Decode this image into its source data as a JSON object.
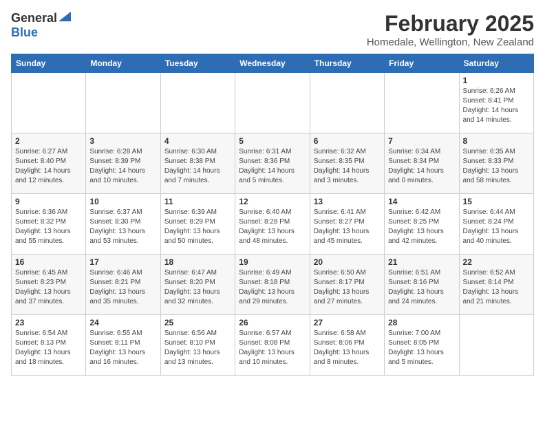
{
  "logo": {
    "general": "General",
    "blue": "Blue"
  },
  "title": "February 2025",
  "location": "Homedale, Wellington, New Zealand",
  "weekdays": [
    "Sunday",
    "Monday",
    "Tuesday",
    "Wednesday",
    "Thursday",
    "Friday",
    "Saturday"
  ],
  "weeks": [
    [
      {
        "day": "",
        "info": ""
      },
      {
        "day": "",
        "info": ""
      },
      {
        "day": "",
        "info": ""
      },
      {
        "day": "",
        "info": ""
      },
      {
        "day": "",
        "info": ""
      },
      {
        "day": "",
        "info": ""
      },
      {
        "day": "1",
        "info": "Sunrise: 6:26 AM\nSunset: 8:41 PM\nDaylight: 14 hours\nand 14 minutes."
      }
    ],
    [
      {
        "day": "2",
        "info": "Sunrise: 6:27 AM\nSunset: 8:40 PM\nDaylight: 14 hours\nand 12 minutes."
      },
      {
        "day": "3",
        "info": "Sunrise: 6:28 AM\nSunset: 8:39 PM\nDaylight: 14 hours\nand 10 minutes."
      },
      {
        "day": "4",
        "info": "Sunrise: 6:30 AM\nSunset: 8:38 PM\nDaylight: 14 hours\nand 7 minutes."
      },
      {
        "day": "5",
        "info": "Sunrise: 6:31 AM\nSunset: 8:36 PM\nDaylight: 14 hours\nand 5 minutes."
      },
      {
        "day": "6",
        "info": "Sunrise: 6:32 AM\nSunset: 8:35 PM\nDaylight: 14 hours\nand 3 minutes."
      },
      {
        "day": "7",
        "info": "Sunrise: 6:34 AM\nSunset: 8:34 PM\nDaylight: 14 hours\nand 0 minutes."
      },
      {
        "day": "8",
        "info": "Sunrise: 6:35 AM\nSunset: 8:33 PM\nDaylight: 13 hours\nand 58 minutes."
      }
    ],
    [
      {
        "day": "9",
        "info": "Sunrise: 6:36 AM\nSunset: 8:32 PM\nDaylight: 13 hours\nand 55 minutes."
      },
      {
        "day": "10",
        "info": "Sunrise: 6:37 AM\nSunset: 8:30 PM\nDaylight: 13 hours\nand 53 minutes."
      },
      {
        "day": "11",
        "info": "Sunrise: 6:39 AM\nSunset: 8:29 PM\nDaylight: 13 hours\nand 50 minutes."
      },
      {
        "day": "12",
        "info": "Sunrise: 6:40 AM\nSunset: 8:28 PM\nDaylight: 13 hours\nand 48 minutes."
      },
      {
        "day": "13",
        "info": "Sunrise: 6:41 AM\nSunset: 8:27 PM\nDaylight: 13 hours\nand 45 minutes."
      },
      {
        "day": "14",
        "info": "Sunrise: 6:42 AM\nSunset: 8:25 PM\nDaylight: 13 hours\nand 42 minutes."
      },
      {
        "day": "15",
        "info": "Sunrise: 6:44 AM\nSunset: 8:24 PM\nDaylight: 13 hours\nand 40 minutes."
      }
    ],
    [
      {
        "day": "16",
        "info": "Sunrise: 6:45 AM\nSunset: 8:23 PM\nDaylight: 13 hours\nand 37 minutes."
      },
      {
        "day": "17",
        "info": "Sunrise: 6:46 AM\nSunset: 8:21 PM\nDaylight: 13 hours\nand 35 minutes."
      },
      {
        "day": "18",
        "info": "Sunrise: 6:47 AM\nSunset: 8:20 PM\nDaylight: 13 hours\nand 32 minutes."
      },
      {
        "day": "19",
        "info": "Sunrise: 6:49 AM\nSunset: 8:18 PM\nDaylight: 13 hours\nand 29 minutes."
      },
      {
        "day": "20",
        "info": "Sunrise: 6:50 AM\nSunset: 8:17 PM\nDaylight: 13 hours\nand 27 minutes."
      },
      {
        "day": "21",
        "info": "Sunrise: 6:51 AM\nSunset: 8:16 PM\nDaylight: 13 hours\nand 24 minutes."
      },
      {
        "day": "22",
        "info": "Sunrise: 6:52 AM\nSunset: 8:14 PM\nDaylight: 13 hours\nand 21 minutes."
      }
    ],
    [
      {
        "day": "23",
        "info": "Sunrise: 6:54 AM\nSunset: 8:13 PM\nDaylight: 13 hours\nand 18 minutes."
      },
      {
        "day": "24",
        "info": "Sunrise: 6:55 AM\nSunset: 8:11 PM\nDaylight: 13 hours\nand 16 minutes."
      },
      {
        "day": "25",
        "info": "Sunrise: 6:56 AM\nSunset: 8:10 PM\nDaylight: 13 hours\nand 13 minutes."
      },
      {
        "day": "26",
        "info": "Sunrise: 6:57 AM\nSunset: 8:08 PM\nDaylight: 13 hours\nand 10 minutes."
      },
      {
        "day": "27",
        "info": "Sunrise: 6:58 AM\nSunset: 8:06 PM\nDaylight: 13 hours\nand 8 minutes."
      },
      {
        "day": "28",
        "info": "Sunrise: 7:00 AM\nSunset: 8:05 PM\nDaylight: 13 hours\nand 5 minutes."
      },
      {
        "day": "",
        "info": ""
      }
    ]
  ]
}
